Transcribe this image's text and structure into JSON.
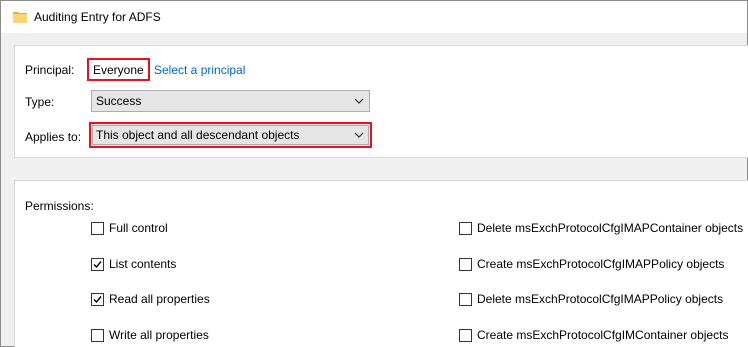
{
  "window": {
    "title": "Auditing Entry for ADFS"
  },
  "principal": {
    "label": "Principal:",
    "value": "Everyone",
    "link": "Select a principal"
  },
  "type": {
    "label": "Type:",
    "value": "Success"
  },
  "applies_to": {
    "label": "Applies to:",
    "value": "This object and all descendant objects"
  },
  "permissions": {
    "label": "Permissions:",
    "left": [
      {
        "label": "Full control",
        "checked": false
      },
      {
        "label": "List contents",
        "checked": true
      },
      {
        "label": "Read all properties",
        "checked": true
      },
      {
        "label": "Write all properties",
        "checked": false
      }
    ],
    "right": [
      {
        "label": "Delete msExchProtocolCfgIMAPContainer objects",
        "checked": false
      },
      {
        "label": "Create msExchProtocolCfgIMAPPolicy objects",
        "checked": false
      },
      {
        "label": "Delete msExchProtocolCfgIMAPPolicy objects",
        "checked": false
      },
      {
        "label": "Create msExchProtocolCfgIMContainer objects",
        "checked": false
      }
    ]
  },
  "colors": {
    "highlight": "#e81123",
    "link": "#0066cc",
    "folder": "#f7d674"
  },
  "icons": {
    "title": "folder-icon",
    "dropdown": "chevron-down-icon",
    "check": "check-icon"
  }
}
